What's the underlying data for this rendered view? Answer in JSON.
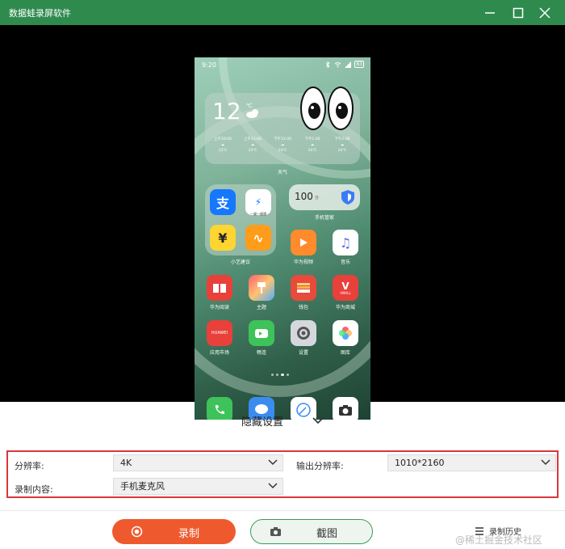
{
  "window": {
    "title": "数据蛙录屏软件"
  },
  "phone": {
    "status_time": "9:20",
    "battery": "83",
    "weather": {
      "temp": "12",
      "unit": "℃",
      "hours": [
        {
          "time": "上午10:00",
          "temp": "13℃"
        },
        {
          "time": "上午11:00",
          "temp": "23℃"
        },
        {
          "time": "下午12:00",
          "temp": "24℃"
        },
        {
          "time": "下午1:00",
          "temp": "24℃"
        },
        {
          "time": "下午2:00",
          "temp": "24℃"
        }
      ],
      "label": "天气"
    },
    "folder": {
      "label": "小艺建议",
      "sub": "一键一键通"
    },
    "manager": {
      "score": "100",
      "unit": "分",
      "label": "手机管家"
    },
    "apps": [
      {
        "label": "华为视频"
      },
      {
        "label": "音乐"
      },
      {
        "label": "华为阅读"
      },
      {
        "label": "主题"
      },
      {
        "label": "钱包"
      },
      {
        "label": "华为商城",
        "badge": "VMALL"
      },
      {
        "label": "应用市场",
        "badge": "HUAWEI"
      },
      {
        "label": "畅连"
      },
      {
        "label": "设置"
      },
      {
        "label": "图库"
      }
    ]
  },
  "settings_toggle": {
    "label": "隐藏设置"
  },
  "settings": {
    "resolution_label": "分辨率:",
    "resolution_value": "4K",
    "output_label": "输出分辨率:",
    "output_value": "1010*2160",
    "content_label": "录制内容:",
    "content_value": "手机麦克风"
  },
  "actions": {
    "record": "录制",
    "screenshot": "截图",
    "history": "录制历史"
  },
  "watermark": "@稀土掘金技术社区",
  "colors": {
    "titlebar": "#2f8a4e",
    "record": "#ee5a2e",
    "highlight": "#d9373b"
  }
}
